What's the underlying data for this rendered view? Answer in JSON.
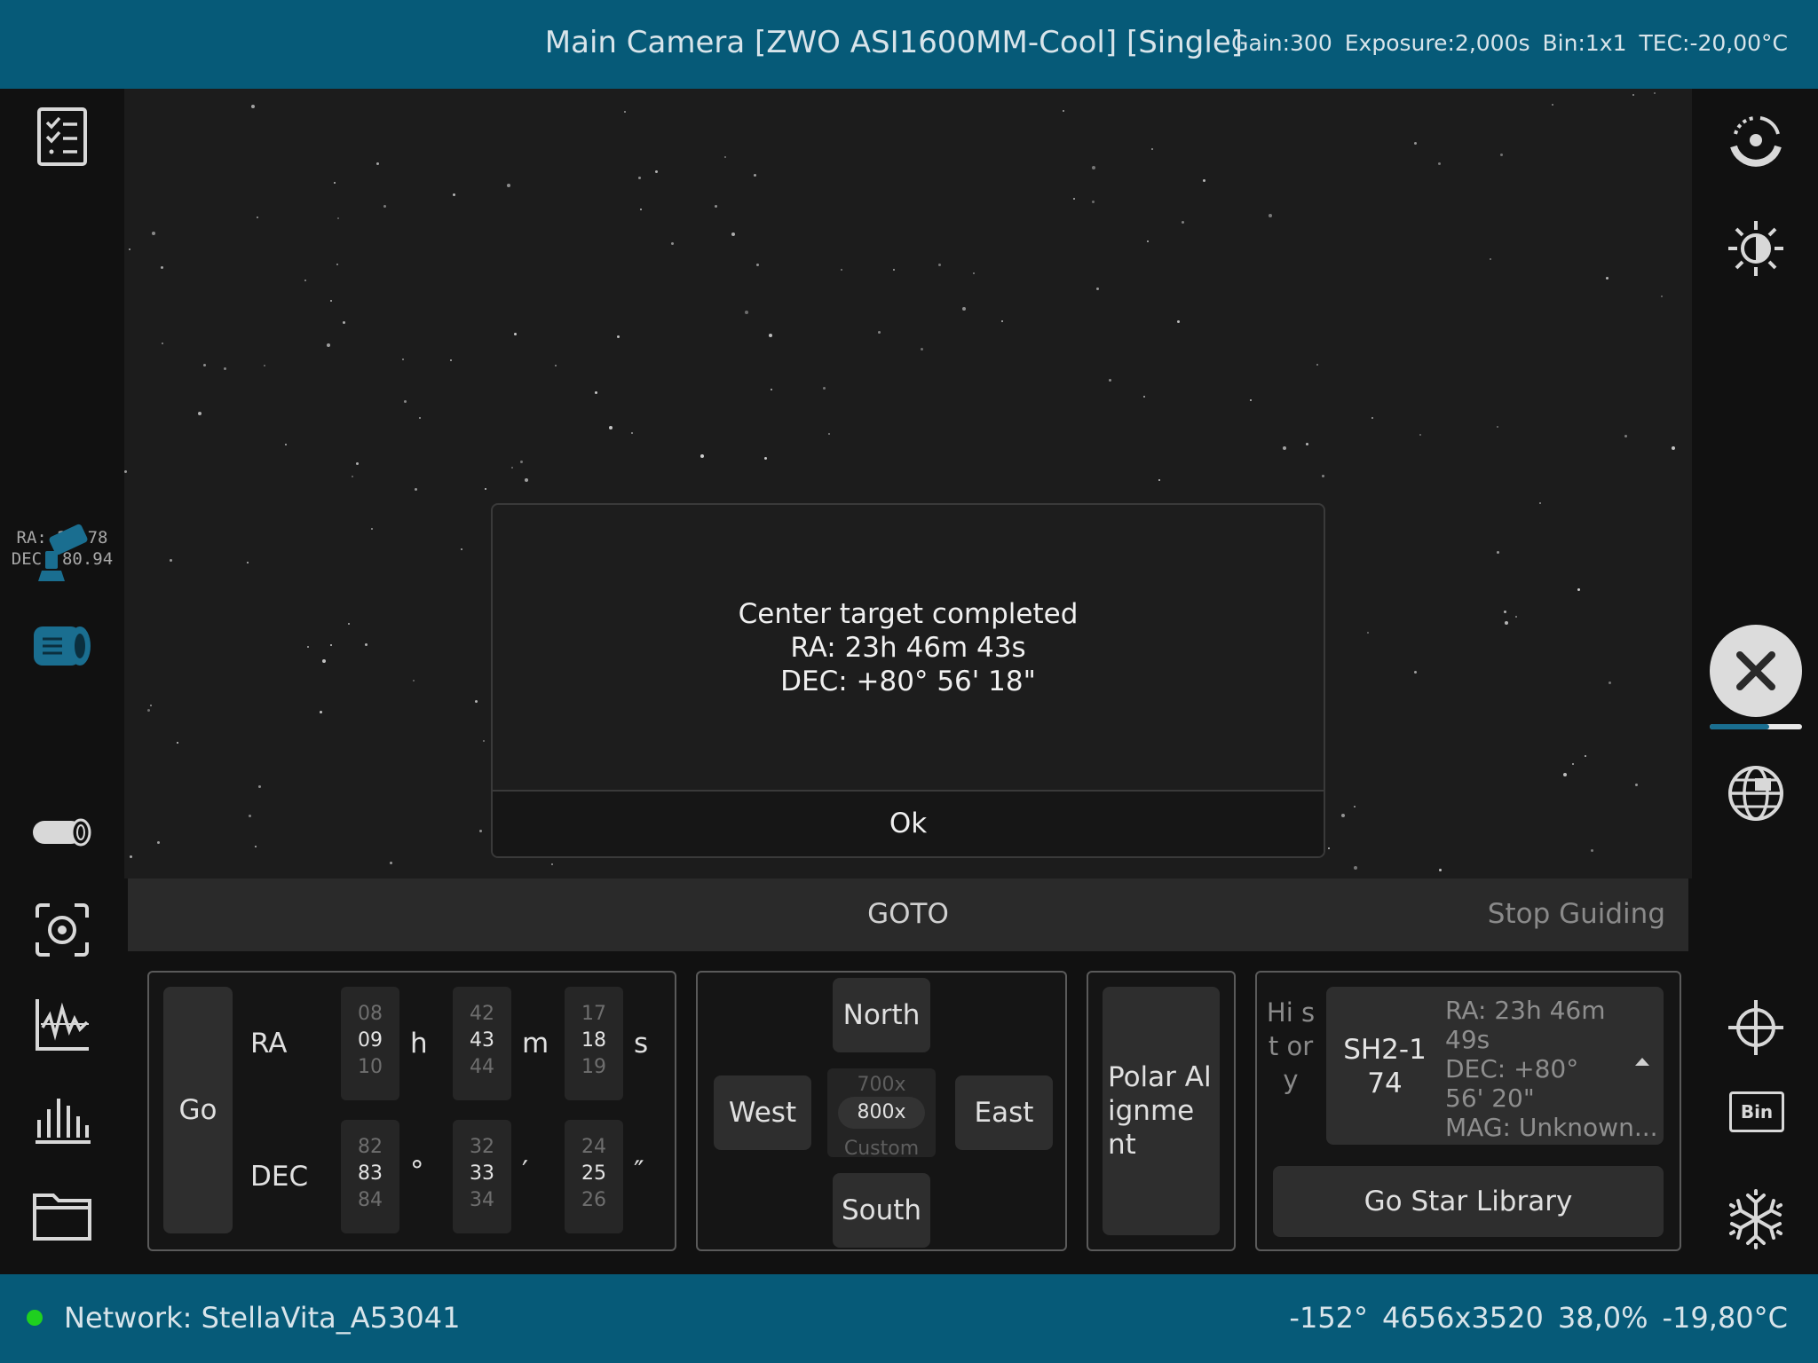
{
  "camera": {
    "title": "Main Camera [ZWO ASI1600MM-Cool] [Single]",
    "gain": "Gain:300",
    "exposure": "Exposure:2,000s",
    "bin": "Bin:1x1",
    "tec": "TEC:-20,00°C"
  },
  "sidebar_readout": {
    "ra": "RA:  23.78",
    "dec": "DEC: 80.94"
  },
  "dialog": {
    "line1": "Center target completed",
    "line2": "RA: 23h 46m 43s",
    "line3": "DEC: +80° 56' 18\"",
    "ok_label": "Ok"
  },
  "goto_panel": {
    "title": "GOTO",
    "stop_guiding": "Stop Guiding",
    "go_label": "Go",
    "ra_label": "RA",
    "dec_label": "DEC",
    "ra_wheels": [
      {
        "prev": "08",
        "cur": "09",
        "next": "10",
        "unit": "h"
      },
      {
        "prev": "42",
        "cur": "43",
        "next": "44",
        "unit": "m"
      },
      {
        "prev": "17",
        "cur": "18",
        "next": "19",
        "unit": "s"
      }
    ],
    "dec_wheels": [
      {
        "prev": "82",
        "cur": "83",
        "next": "84",
        "unit": "°"
      },
      {
        "prev": "32",
        "cur": "33",
        "next": "34",
        "unit": "′"
      },
      {
        "prev": "24",
        "cur": "25",
        "next": "26",
        "unit": "″"
      }
    ],
    "north": "North",
    "south": "South",
    "west": "West",
    "east": "East",
    "speed_prev": "700x",
    "speed": "800x",
    "speed_next": "Custom",
    "polar_alignment": "Polar Alignme nt",
    "history_label": "Hi st or y",
    "target_name": "SH2-1 74",
    "target_ra": "RA: 23h 46m 49s",
    "target_dec": "DEC: +80° 56' 20\"",
    "target_mag": "MAG: Unknown...",
    "star_library": "Go Star Library"
  },
  "status": {
    "network": "Network: StellaVita_A53041",
    "angle": "-152°",
    "resolution": "4656x3520",
    "percent": "38,0%",
    "temperature": "-19,80°C"
  },
  "colors": {
    "bars": "#065a78",
    "accent": "#1a6e90",
    "network_dot": "#1fd01f"
  },
  "icons": {
    "left": [
      "checklist-icon",
      "telescope-mount-icon",
      "camera-icon",
      "filter-wheel-icon",
      "focus-capture-icon",
      "guide-graph-icon",
      "histogram-icon",
      "folder-icon",
      "settings-gear-icon"
    ],
    "right": [
      "auto-stretch-icon",
      "brightness-icon",
      "close-capture-icon",
      "globe-plate-solve-icon",
      "crosshair-icon",
      "bin-icon",
      "cooler-snowflake-icon"
    ]
  }
}
